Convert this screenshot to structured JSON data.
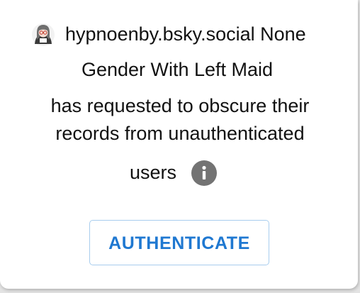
{
  "profile": {
    "handle": "hypnoenby.bsky.social None",
    "display_name": "Gender With Left Maid",
    "avatar_icon": "avatar-person-with-glasses"
  },
  "message": {
    "line1": "has requested to obscure their",
    "line2": "records from unauthenticated",
    "line3": "users",
    "info_icon": "info-circle-icon"
  },
  "actions": {
    "authenticate_label": "AUTHENTICATE"
  },
  "colors": {
    "accent": "#1f78d1",
    "button_border": "#a8cdee",
    "icon_gray": "#737373",
    "text": "#111111"
  }
}
